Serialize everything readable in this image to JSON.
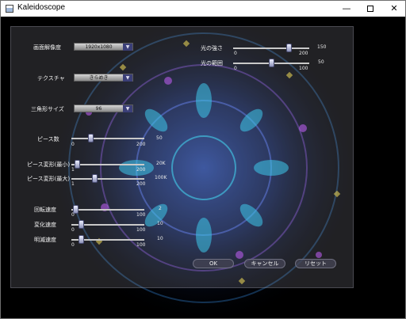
{
  "window": {
    "title": "Kaleidoscope",
    "minimize_glyph": "—",
    "close_glyph": "✕"
  },
  "settings": {
    "resolution": {
      "label": "画面解像度",
      "value": "1920x1080"
    },
    "texture": {
      "label": "テクスチャ",
      "value": "きらめき"
    },
    "triangle_size": {
      "label": "三角形サイズ",
      "value": "96"
    },
    "pieces": {
      "label": "ピース数",
      "min": "0",
      "max": "200",
      "value": "50",
      "fraction": 0.25
    },
    "deform_min": {
      "label": "ピース変形(最小)",
      "min": "1",
      "max": "200",
      "value": "20K",
      "fraction": 0.05
    },
    "deform_max": {
      "label": "ピース変形(最大)",
      "min": "1",
      "max": "200",
      "value": "100K",
      "fraction": 0.3
    },
    "rotation": {
      "label": "回転速度",
      "min": "0",
      "max": "100",
      "value": "2",
      "fraction": 0.02
    },
    "change": {
      "label": "変化速度",
      "min": "0",
      "max": "100",
      "value": "10",
      "fraction": 0.1
    },
    "blink": {
      "label": "明滅速度",
      "min": "0",
      "max": "100",
      "value": "10",
      "fraction": 0.1
    },
    "light_strength": {
      "label": "光の強さ",
      "min": "0",
      "max": "200",
      "value": "150",
      "fraction": 0.75
    },
    "light_range": {
      "label": "光の範囲",
      "min": "0",
      "max": "100",
      "value": "50",
      "fraction": 0.5
    }
  },
  "buttons": {
    "ok": "OK",
    "cancel": "キャンセル",
    "reset": "リセット"
  },
  "icons": {
    "combo_arrow": "▼"
  },
  "colors": {
    "combo_arrow_bg": "#3b3f78",
    "panel": "#9696a5",
    "title_bar": "#ffffff"
  }
}
